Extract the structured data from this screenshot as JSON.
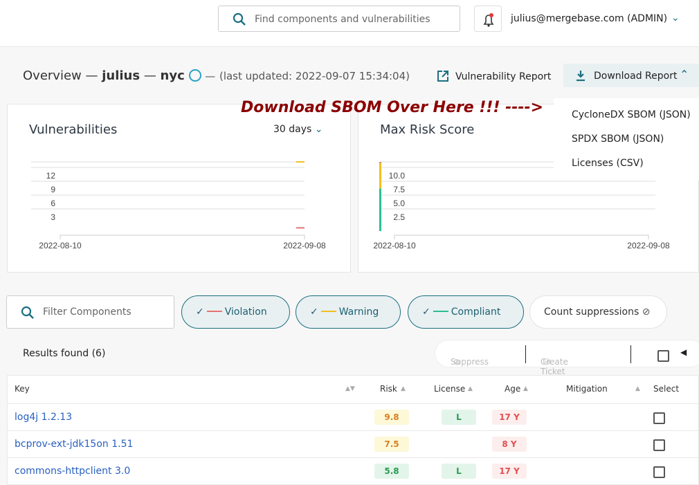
{
  "header": {
    "search_placeholder": "Find components and vulnerabilities",
    "user": "julius@mergebase.com (ADMIN)"
  },
  "overview": {
    "label": "Overview",
    "sep": "—",
    "user": "julius",
    "project": "nyc",
    "updated": "(last updated: 2022-09-07 15:34:04)",
    "vuln_report": "Vulnerability Report",
    "download_report": "Download Report"
  },
  "download_menu": [
    "CycloneDX SBOM (JSON)",
    "SPDX SBOM (JSON)",
    "Licenses (CSV)"
  ],
  "callout": "Download SBOM Over Here !!! ---->",
  "colors": {
    "violation": "#e57373",
    "warning": "#f0c020",
    "compliant": "#2bbf93",
    "accent": "#1b6f80"
  },
  "chart_data": [
    {
      "type": "line",
      "title": "Vulnerabilities",
      "range_selector": "30 days",
      "x": [
        "2022-08-10",
        "2022-09-08"
      ],
      "yticks": [
        "3",
        "6",
        "9",
        "12"
      ],
      "ylim": [
        0,
        15
      ],
      "grid": true,
      "series": [
        {
          "color": "#f0c020",
          "points": [
            [
              "2022-09-08",
              15
            ]
          ]
        },
        {
          "color": "#e57373",
          "points": [
            [
              "2022-09-08",
              0.7
            ]
          ]
        }
      ]
    },
    {
      "type": "bar",
      "title": "Max Risk Score",
      "x": [
        "2022-08-10",
        "2022-09-08"
      ],
      "yticks": [
        "2.5",
        "5.0",
        "7.5",
        "10.0"
      ],
      "ylim": [
        0,
        12.5
      ],
      "grid": true,
      "risk_bar": [
        {
          "from": 0,
          "to": 7.7,
          "color": "#2bbf93"
        },
        {
          "from": 7.7,
          "to": 12.3,
          "color": "#f0c020"
        },
        {
          "from": 12.3,
          "to": 12.5,
          "color": "#e57373"
        }
      ]
    }
  ],
  "filters": {
    "placeholder": "Filter Components",
    "violation": "Violation",
    "warning": "Warning",
    "compliant": "Compliant",
    "count_suppressions": "Count suppressions"
  },
  "results": {
    "label": "Results found (6)",
    "suppress": "Suppress",
    "create_ticket": "Create Ticket"
  },
  "table": {
    "columns": {
      "key": "Key",
      "risk": "Risk",
      "license": "License",
      "age": "Age",
      "mitigation": "Mitigation",
      "select": "Select"
    },
    "rows": [
      {
        "key": "log4j 1.2.13",
        "risk": "9.8",
        "risk_level": "high",
        "license": "L",
        "age": "17 Y"
      },
      {
        "key": "bcprov-ext-jdk15on 1.51",
        "risk": "7.5",
        "risk_level": "high",
        "license": "",
        "age": "8 Y"
      },
      {
        "key": "commons-httpclient 3.0",
        "risk": "5.8",
        "risk_level": "medium",
        "license": "L",
        "age": "17 Y"
      }
    ]
  }
}
